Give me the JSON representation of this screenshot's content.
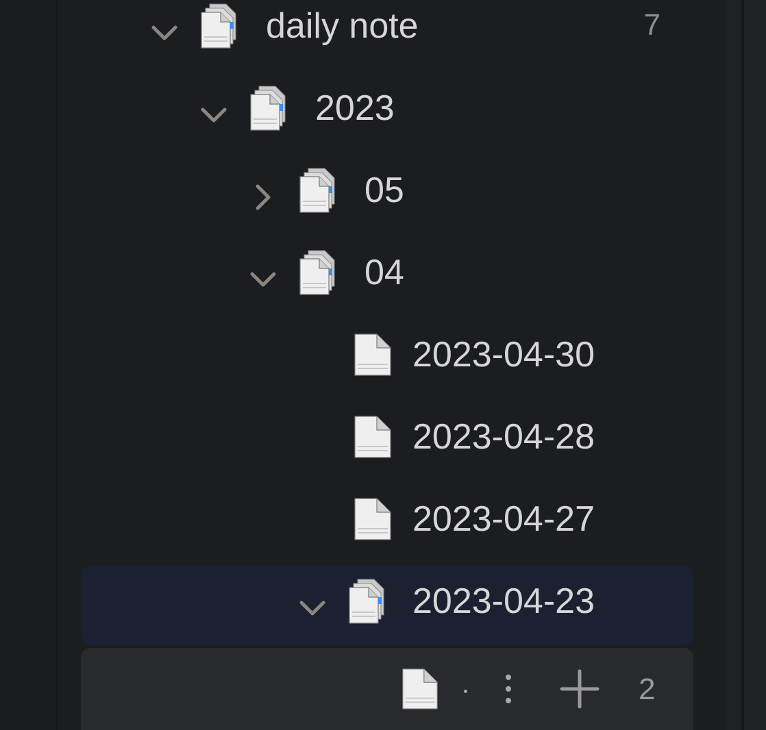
{
  "tree": {
    "items": [
      {
        "label": "daily note",
        "count": "7",
        "type": "folder",
        "expanded": true
      },
      {
        "label": "2023",
        "type": "folder",
        "expanded": true
      },
      {
        "label": "05",
        "type": "folder",
        "expanded": false
      },
      {
        "label": "04",
        "type": "folder",
        "expanded": true
      },
      {
        "label": "2023-04-30",
        "type": "file"
      },
      {
        "label": "2023-04-28",
        "type": "file"
      },
      {
        "label": "2023-04-27",
        "type": "file"
      },
      {
        "label": "2023-04-23",
        "type": "folder",
        "expanded": true,
        "selected": true
      }
    ]
  },
  "footer_row": {
    "count": "2",
    "icons": [
      "file-icon",
      "more-vertical-icon",
      "plus-icon"
    ]
  },
  "colors": {
    "background": "#1c1d20",
    "selected": "#1b2130",
    "hover": "#282a2d",
    "text": "#d6d6d6",
    "muted": "#8f8f8f",
    "accent": "#3d8bff"
  }
}
